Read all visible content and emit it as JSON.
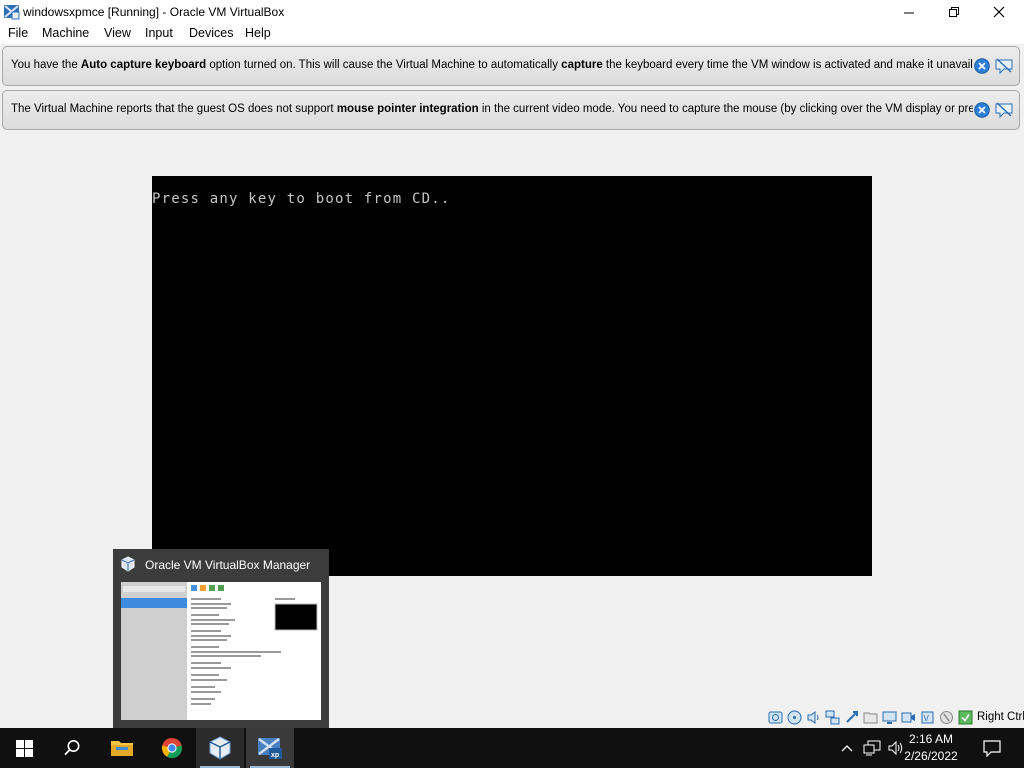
{
  "window": {
    "title": "windowsxpmce [Running] - Oracle VM VirtualBox"
  },
  "menu": {
    "items": [
      "File",
      "Machine",
      "View",
      "Input",
      "Devices",
      "Help"
    ]
  },
  "notices": [
    {
      "parts": [
        {
          "text": "You have the ",
          "bold": false
        },
        {
          "text": "Auto capture keyboard",
          "bold": true
        },
        {
          "text": " option turned on. This will cause the Virtual Machine to automatically ",
          "bold": false
        },
        {
          "text": "capture",
          "bold": true
        },
        {
          "text": " the keyboard every time the VM window is activated and make it unavailable to",
          "bold": false
        }
      ]
    },
    {
      "parts": [
        {
          "text": "The Virtual Machine reports that the guest OS does not support ",
          "bold": false
        },
        {
          "text": "mouse pointer integration",
          "bold": true
        },
        {
          "text": " in the current video mode. You need to capture the mouse (by clicking over the VM display or pressing",
          "bold": false
        }
      ]
    }
  ],
  "vm": {
    "console_text": "Press any key to boot from CD.."
  },
  "taskbar_preview": {
    "title": "Oracle VM VirtualBox Manager"
  },
  "statusbar": {
    "icons": [
      "hard-disk-icon",
      "optical-drive-icon",
      "audio-icon",
      "network-icon",
      "usb-icon",
      "shared-folders-icon",
      "display-icon",
      "video-capture-icon",
      "cpu-icon",
      "mouse-integration-icon",
      "keyboard-capture-icon"
    ],
    "host_key": "Right Ctrl"
  },
  "taskbar": {
    "time": "2:16 AM",
    "date": "2/26/2022"
  },
  "colors": {
    "vm_background": "#000000",
    "console_text": "#c4c4c4",
    "taskbar": "#101010",
    "preview_popup": "#3c3c3c"
  }
}
